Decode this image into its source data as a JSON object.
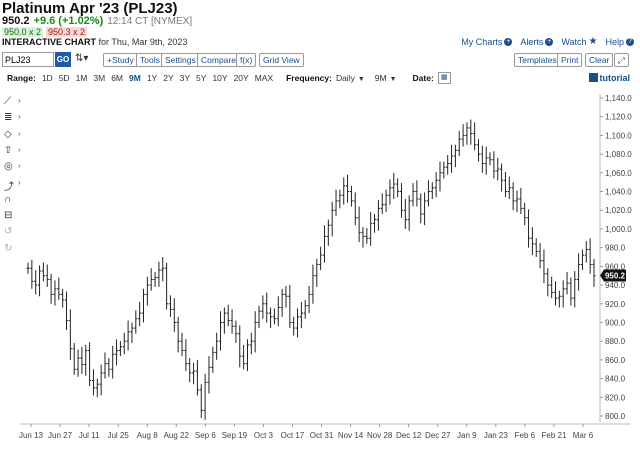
{
  "header": {
    "title": "Platinum Apr '23 (PLJ23)",
    "last": "950.2",
    "change": "+9.6 (+1.02%)",
    "time": "12:14 CT [NYMEX]",
    "bid": "950.0 x 2",
    "ask": "950.3 x 2",
    "chart_label": "INTERACTIVE CHART",
    "chart_date": "for Thu, Mar 9th, 2023"
  },
  "top_links": {
    "my_charts": "My Charts",
    "alerts": "Alerts",
    "watch": "Watch",
    "help": "Help"
  },
  "toolbar": {
    "symbol_value": "PLJ23",
    "go_label": "GO",
    "study_label": "+Study",
    "tools_label": "Tools",
    "settings_label": "Settings",
    "compare_label": "Compare",
    "fx_label": "f(x)",
    "gridview_label": "Grid View",
    "templates_label": "Templates",
    "print_label": "Print",
    "clear_label": "Clear"
  },
  "range_bar": {
    "range_label": "Range:",
    "ranges": [
      "1D",
      "5D",
      "1M",
      "3M",
      "6M",
      "9M",
      "1Y",
      "2Y",
      "3Y",
      "5Y",
      "10Y",
      "20Y",
      "MAX"
    ],
    "active_range": "9M",
    "frequency_label": "Frequency:",
    "frequency_value": "Daily",
    "period_value": "9M",
    "date_label": "Date:",
    "tutorial_label": "tutorial"
  },
  "side_tools": [
    "line-draw-icon",
    "fib-icon",
    "shapes-icon",
    "arrow-icon",
    "target-icon",
    "trend-icon",
    "magnet-icon",
    "lock-icon",
    "undo-icon",
    "redo-icon"
  ],
  "colors": {
    "accent": "#1a4f8a",
    "go": "#1e5aa8",
    "up": "#1a8a1a",
    "down": "#a31d1d",
    "bars": "#222222"
  },
  "chart_data": {
    "type": "ohlc-bar",
    "current_price_label": "950.2",
    "ylim": [
      800,
      1140
    ],
    "yticks": [
      800,
      820,
      840,
      860,
      880,
      900,
      920,
      940,
      960,
      980,
      1000,
      1020,
      1040,
      1060,
      1080,
      1100,
      1120,
      1140
    ],
    "ytick_labels": [
      "800.0",
      "820.0",
      "840.0",
      "860.0",
      "880.0",
      "900.0",
      "920.0",
      "940.0",
      "960.0",
      "980.0",
      "1,000.0",
      "1,020.0",
      "1,040.0",
      "1,060.0",
      "1,080.0",
      "1,100.0",
      "1,120.0",
      "1,140.0"
    ],
    "xtick_labels": [
      "Jun 13",
      "Jun 27",
      "Jul 11",
      "Jul 25",
      "Aug 8",
      "Aug 22",
      "Sep 6",
      "Sep 19",
      "Oct 3",
      "Oct 17",
      "Oct 31",
      "Nov 14",
      "Nov 28",
      "Dec 12",
      "Dec 27",
      "Jan 9",
      "Jan 23",
      "Feb 6",
      "Feb 21",
      "Mar 6"
    ],
    "series": [
      {
        "values": [
          958,
          944,
          940,
          955,
          950,
          946,
          930,
          936,
          930,
          924,
          902,
          872,
          850,
          862,
          855,
          870,
          838,
          830,
          834,
          846,
          856,
          850,
          866,
          870,
          874,
          880,
          890,
          894,
          904,
          910,
          930,
          940,
          946,
          948,
          956,
          958,
          920,
          914,
          900,
          880,
          870,
          856,
          846,
          848,
          828,
          806,
          836,
          852,
          868,
          880,
          900,
          910,
          902,
          896,
          888,
          864,
          856,
          876,
          880,
          900,
          912,
          920,
          910,
          906,
          904,
          916,
          930,
          928,
          900,
          894,
          906,
          910,
          918,
          930,
          950,
          962,
          972,
          992,
          1004,
          1020,
          1030,
          1036,
          1046,
          1040,
          1030,
          1012,
          996,
          992,
          990,
          1006,
          1010,
          1022,
          1026,
          1036,
          1044,
          1048,
          1040,
          1020,
          1010,
          1030,
          1040,
          1032,
          1016,
          1030,
          1040,
          1044,
          1052,
          1060,
          1066,
          1070,
          1078,
          1084,
          1096,
          1100,
          1108,
          1102,
          1090,
          1080,
          1070,
          1076,
          1074,
          1062,
          1064,
          1052,
          1040,
          1044,
          1030,
          1032,
          1022,
          1012,
          990,
          984,
          976,
          966,
          952,
          940,
          932,
          926,
          928,
          936,
          942,
          926,
          946,
          962,
          972,
          978,
          962,
          950
        ]
      }
    ]
  }
}
